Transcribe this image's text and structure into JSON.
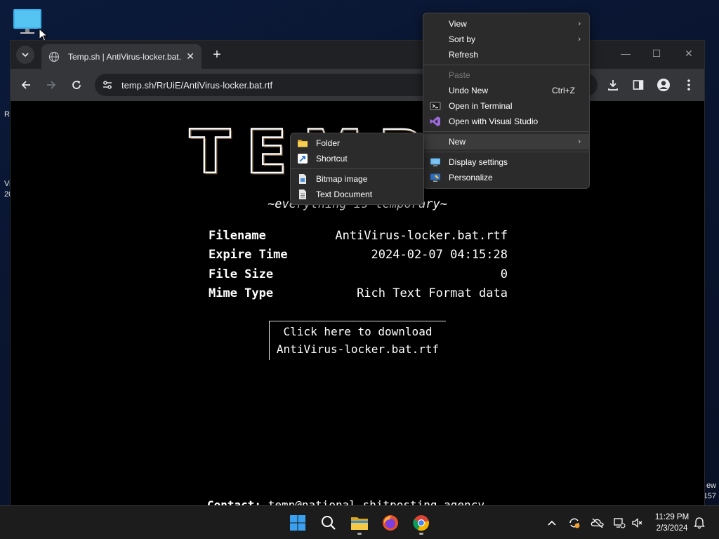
{
  "desktop": {
    "icon_name": "this-pc-icon",
    "left_texts": [
      "R",
      "Vi",
      "20"
    ],
    "right_texts": [
      "ew",
      "157"
    ]
  },
  "browser": {
    "tab_title": "Temp.sh | AntiVirus-locker.bat.rtf",
    "url": "temp.sh/RrUiE/AntiVirus-locker.bat.rtf"
  },
  "page": {
    "logo_text": "TEMP.SH",
    "tagline": "~everything is temporary~",
    "rows": [
      {
        "key": "Filename",
        "value": "AntiVirus-locker.bat.rtf"
      },
      {
        "key": "Expire Time",
        "value": "2024-02-07 04:15:28"
      },
      {
        "key": "File Size",
        "value": "0"
      },
      {
        "key": "Mime Type",
        "value": "Rich Text Format data"
      }
    ],
    "download_line1": "Click here to download",
    "download_line2": "AntiVirus-locker.bat.rtf",
    "contact_label": "Contact:",
    "contact_value": "temp@national.shitposting.agency"
  },
  "context_menu": {
    "items": [
      {
        "label": "View"
      },
      {
        "label": "Sort by"
      },
      {
        "label": "Refresh"
      },
      {
        "label": "Paste"
      },
      {
        "label": "Undo New",
        "shortcut": "Ctrl+Z"
      },
      {
        "label": "Open in Terminal"
      },
      {
        "label": "Open with Visual Studio"
      },
      {
        "label": "New"
      },
      {
        "label": "Display settings"
      },
      {
        "label": "Personalize"
      }
    ]
  },
  "new_submenu": {
    "items": [
      {
        "label": "Folder"
      },
      {
        "label": "Shortcut"
      },
      {
        "label": "Bitmap image"
      },
      {
        "label": "Text Document"
      }
    ]
  },
  "taskbar": {
    "time": "11:29 PM",
    "date": "2/3/2024"
  }
}
